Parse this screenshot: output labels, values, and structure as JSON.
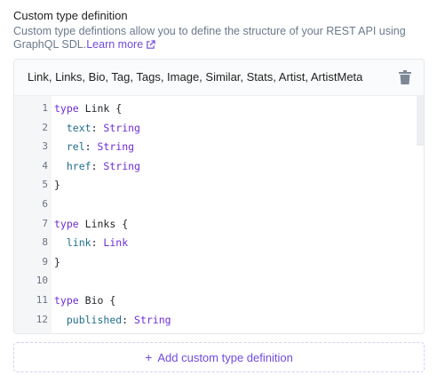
{
  "section": {
    "title": "Custom type definition",
    "description": "Custom type defintions allow you to define the structure of your REST API using GraphQL SDL.",
    "learn_more": "Learn more"
  },
  "panel": {
    "types_summary": "Link, Links, Bio, Tag, Tags, Image, Similar, Stats, Artist, ArtistMeta",
    "line_numbers": [
      "1",
      "2",
      "3",
      "4",
      "5",
      "6",
      "7",
      "8",
      "9",
      "10",
      "11",
      "12"
    ],
    "code_lines": [
      {
        "kw": "type",
        "name": "Link",
        "brace": "{"
      },
      {
        "field": "text",
        "type": "String"
      },
      {
        "field": "rel",
        "type": "String"
      },
      {
        "field": "href",
        "type": "String"
      },
      {
        "close": "}"
      },
      {},
      {
        "kw": "type",
        "name": "Links",
        "brace": "{"
      },
      {
        "field": "link",
        "type": "Link"
      },
      {
        "close": "}"
      },
      {},
      {
        "kw": "type",
        "name": "Bio",
        "brace": "{"
      },
      {
        "field": "published",
        "type": "String"
      }
    ]
  },
  "add_button": {
    "plus": "+",
    "label": "Add custom type definition"
  },
  "colors": {
    "accent": "#6f4be0",
    "keyword": "#6f2ed6",
    "field": "#1f6f8b",
    "muted_text": "#6b7a8c"
  },
  "icons": {
    "external": "external-link-icon",
    "delete": "trash-icon",
    "add": "plus-icon"
  }
}
